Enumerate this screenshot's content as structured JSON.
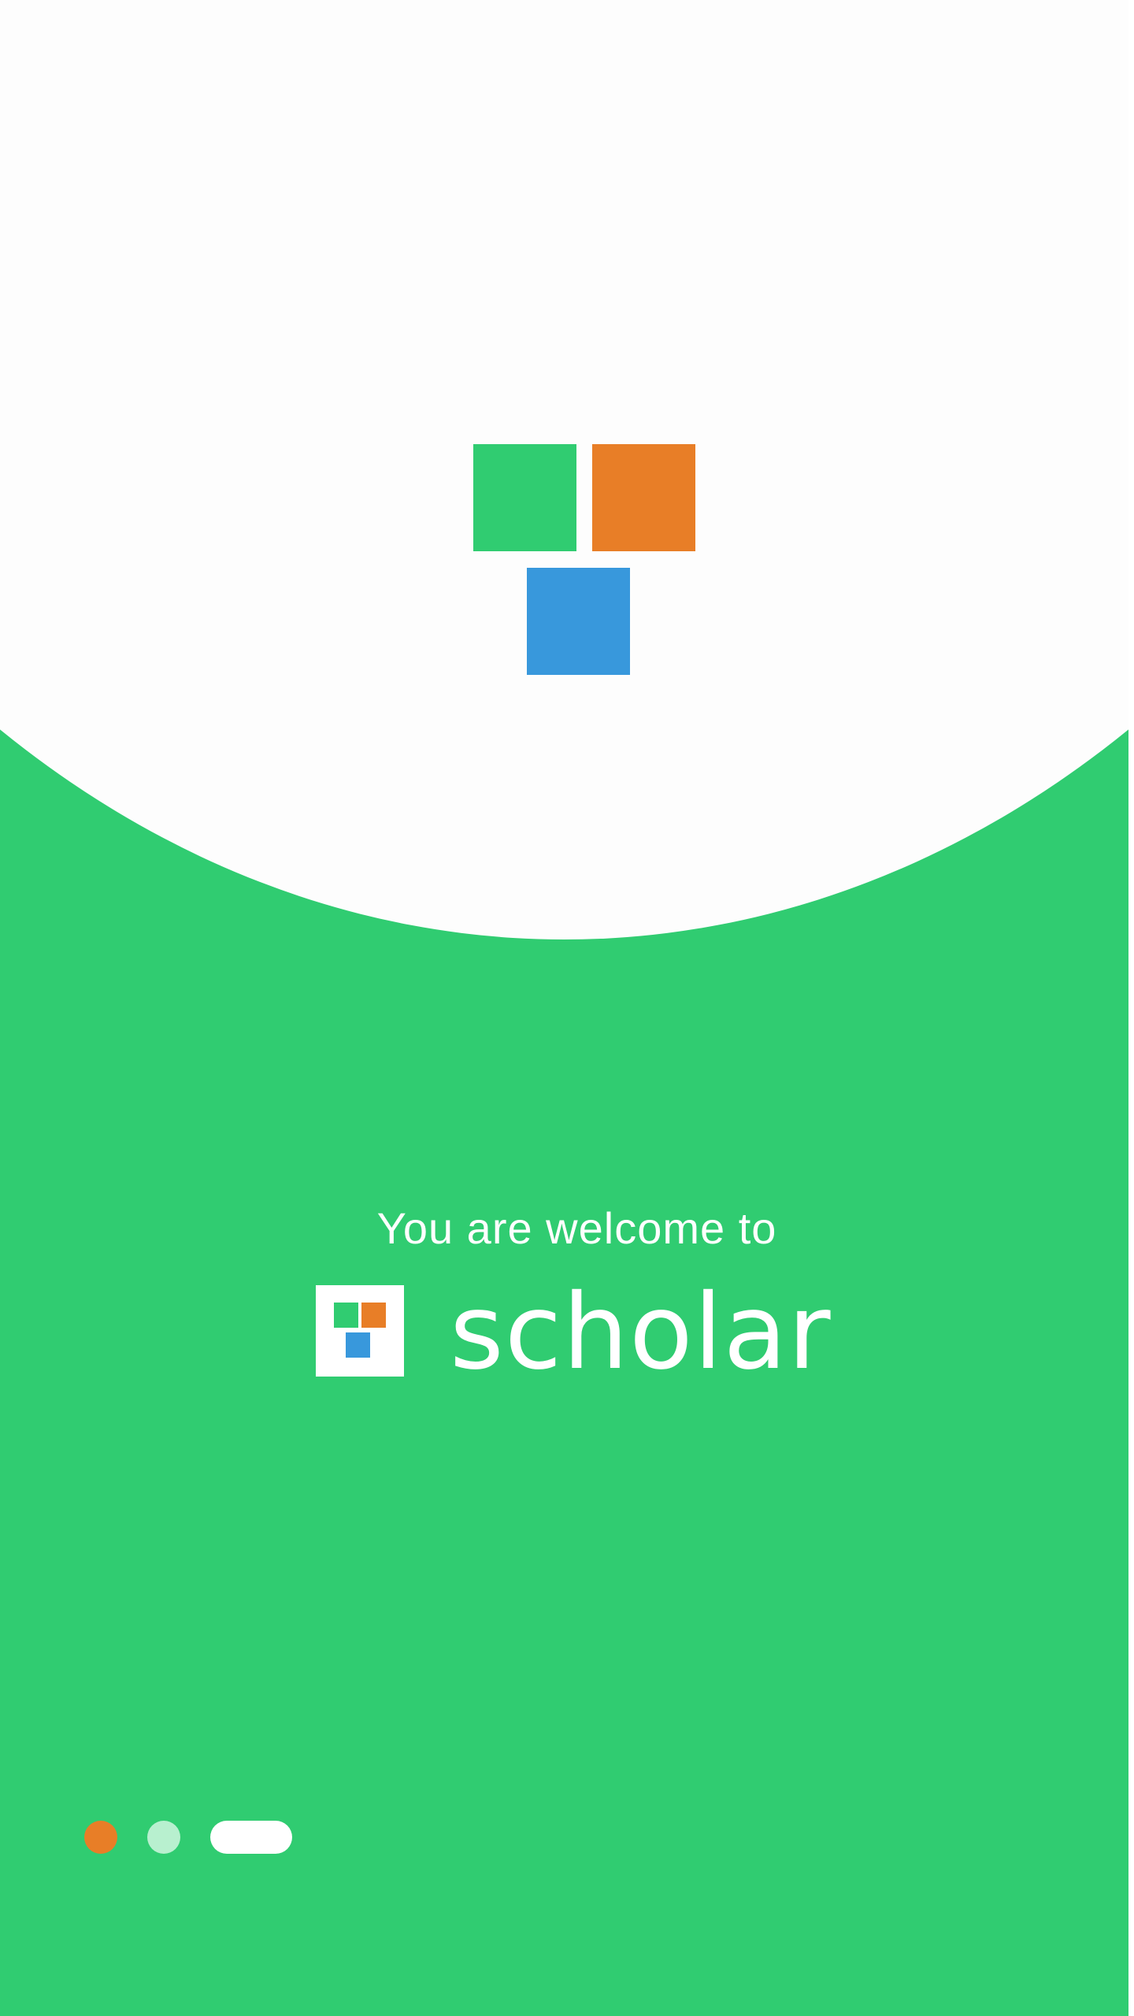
{
  "welcome": {
    "greeting": "You are welcome to",
    "brand_name": "scholar"
  },
  "logo": {
    "squares": [
      {
        "name": "green",
        "color": "#30cc71"
      },
      {
        "name": "orange",
        "color": "#e87e27"
      },
      {
        "name": "blue",
        "color": "#3898dc"
      }
    ]
  },
  "pager": {
    "page_count": 3,
    "active_index": 2,
    "colors": [
      "#e87e27",
      "#b8f0cf",
      "#ffffff"
    ]
  },
  "theme": {
    "background": "#30cc71",
    "surface": "#fdfdfd",
    "text": "#ffffff"
  }
}
